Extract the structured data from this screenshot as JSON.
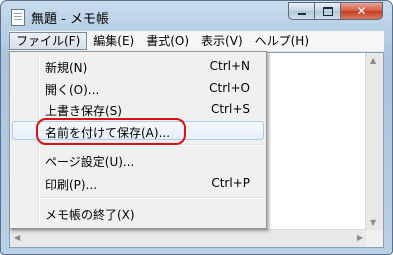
{
  "window": {
    "title": "無題 - メモ帳",
    "buttons": {
      "minimize": "minimize",
      "maximize": "maximize",
      "close": "✕"
    }
  },
  "menubar": {
    "items": [
      {
        "label": "ファイル(F)"
      },
      {
        "label": "編集(E)"
      },
      {
        "label": "書式(O)"
      },
      {
        "label": "表示(V)"
      },
      {
        "label": "ヘルプ(H)"
      }
    ]
  },
  "file_menu": {
    "items": [
      {
        "label": "新規(N)",
        "shortcut": "Ctrl+N"
      },
      {
        "label": "開く(O)...",
        "shortcut": "Ctrl+O"
      },
      {
        "label": "上書き保存(S)",
        "shortcut": "Ctrl+S"
      },
      {
        "label": "名前を付けて保存(A)...",
        "shortcut": ""
      },
      {
        "label": "ページ設定(U)...",
        "shortcut": ""
      },
      {
        "label": "印刷(P)...",
        "shortcut": "Ctrl+P"
      },
      {
        "label": "メモ帳の終了(X)",
        "shortcut": ""
      }
    ],
    "highlighted_index": 3
  },
  "annotation": {
    "color": "#e01010"
  },
  "icons": [
    "notepad-icon",
    "minimize-icon",
    "maximize-icon",
    "close-icon",
    "scroll-up-icon",
    "scroll-down-icon",
    "scroll-left-icon",
    "scroll-right-icon"
  ]
}
